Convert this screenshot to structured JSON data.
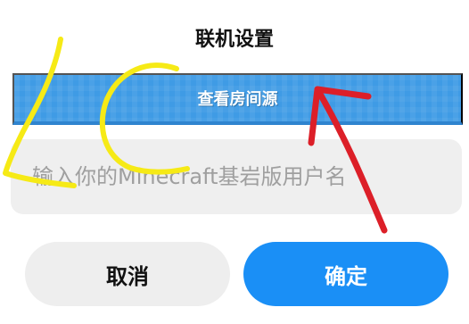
{
  "dialog": {
    "title": "联机设置",
    "room_source_button": "查看房间源",
    "username_placeholder": "输入你的Minecraft基岩版用户名",
    "cancel_label": "取消",
    "confirm_label": "确定"
  },
  "colors": {
    "banner_blue": "#3f9be5",
    "primary_button": "#1a8ff6",
    "annotation_yellow": "#f6ea16",
    "annotation_red": "#dc1f28"
  }
}
